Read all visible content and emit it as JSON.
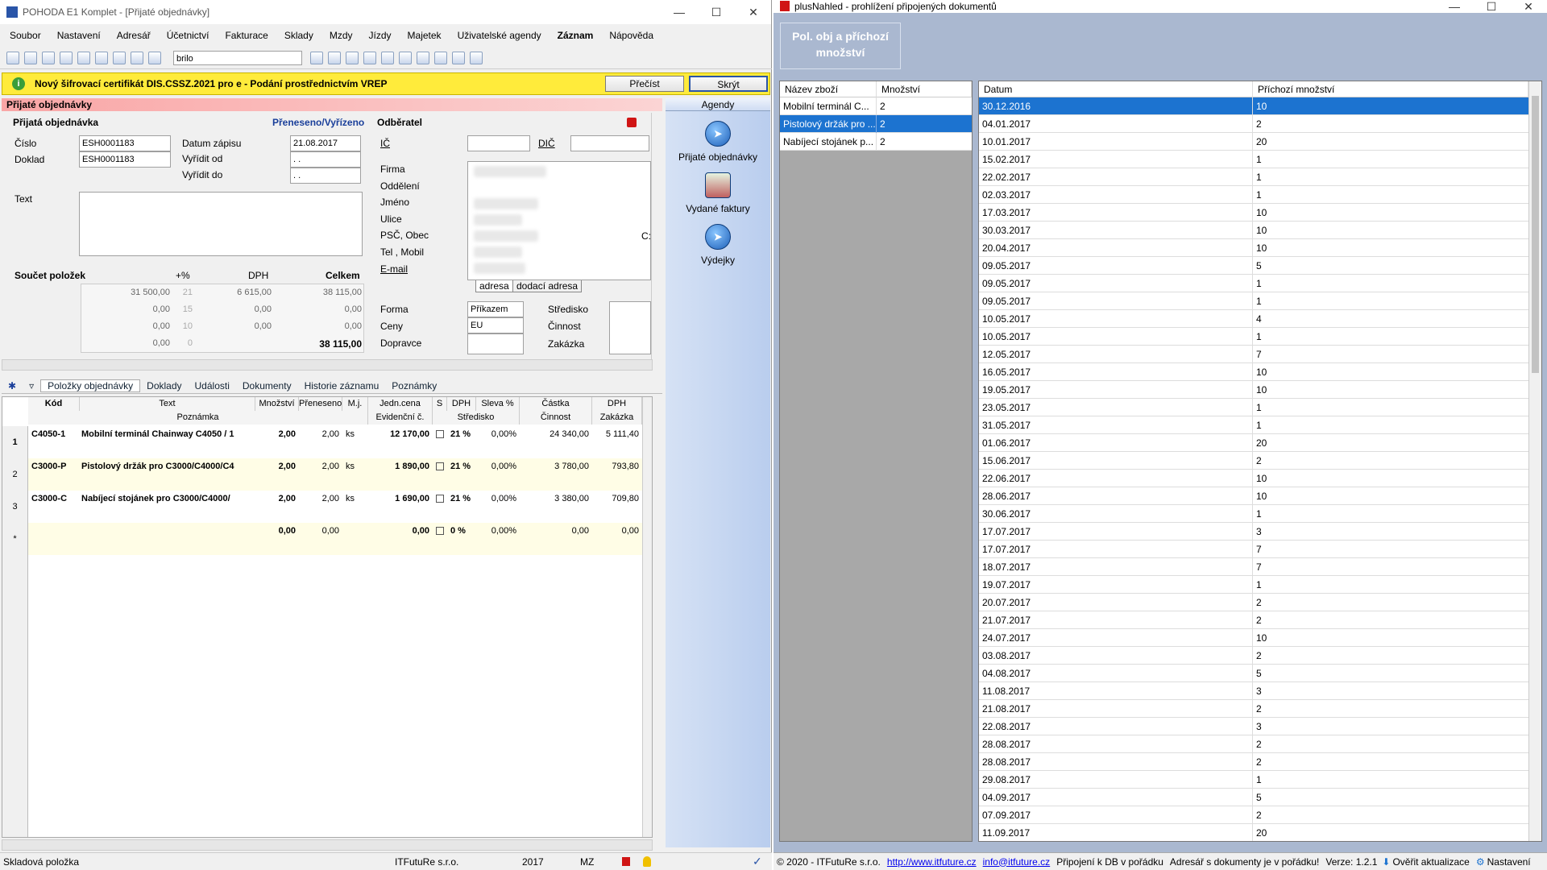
{
  "left": {
    "title": "POHODA E1 Komplet - [Přijaté objednávky]",
    "menu": [
      "Soubor",
      "Nastavení",
      "Adresář",
      "Účetnictví",
      "Fakturace",
      "Sklady",
      "Mzdy",
      "Jízdy",
      "Majetek",
      "Uživatelské agendy",
      "Záznam",
      "Nápověda"
    ],
    "search_value": "brilo",
    "notice": {
      "text": "Nový šifrovací certifikát DIS.CSSZ.2021 pro e - Podání prostřednictvím VREP",
      "read": "Přečíst",
      "hide": "Skrýt"
    },
    "section_title": "Přijaté objednávky",
    "form": {
      "order_label": "Přijatá objednávka",
      "status": "Přeneseno/Vyřízeno",
      "buyer": "Odběratel",
      "cislo_label": "Číslo",
      "cislo": "ESH0001183",
      "doklad_label": "Doklad",
      "doklad": "ESH0001183",
      "datum_zapisu_label": "Datum zápisu",
      "datum_zapisu": "21.08.2017",
      "vyridit_od_label": "Vyřídit od",
      "vyridit_od": ". .",
      "vyridit_do_label": "Vyřídit do",
      "vyridit_do": ". .",
      "text_label": "Text",
      "ic_label": "IČ",
      "dic_label": "DIČ",
      "firma": "Firma",
      "oddeleni": "Oddělení",
      "jmeno": "Jméno",
      "ulice": "Ulice",
      "psc": "PSČ, Obec",
      "tel": "Tel , Mobil",
      "email": "E-mail",
      "tab_adresa": "adresa",
      "tab_dodaci": "dodací adresa",
      "forma_label": "Forma",
      "forma": "Příkazem",
      "ceny_label": "Ceny",
      "ceny": "EU",
      "dopravce_label": "Dopravce",
      "stredisko": "Středisko",
      "cinnost": "Činnost",
      "zakazka": "Zakázka",
      "c_trunc": "C:"
    },
    "sums": {
      "title": "Součet položek",
      "pct": "+%",
      "dph": "DPH",
      "celkem": "Celkem",
      "rows": [
        [
          "31 500,00",
          "21",
          "6 615,00",
          "38 115,00"
        ],
        [
          "0,00",
          "15",
          "0,00",
          "0,00"
        ],
        [
          "0,00",
          "10",
          "0,00",
          "0,00"
        ],
        [
          "0,00",
          "0",
          "",
          "38 115,00"
        ]
      ]
    },
    "agenda": {
      "title": "Agendy",
      "items": [
        "Přijaté objednávky",
        "Vydané faktury",
        "Výdejky"
      ]
    },
    "tabs": [
      "Položky objednávky",
      "Doklady",
      "Události",
      "Dokumenty",
      "Historie záznamu",
      "Poznámky"
    ],
    "grid": {
      "headers1": [
        "Kód",
        "Text",
        "Množství",
        "Přeneseno",
        "M.j.",
        "Jedn.cena",
        "S",
        "DPH",
        "Sleva %",
        "Částka",
        "DPH"
      ],
      "headers2": [
        "Poznámka",
        "Evidenční č.",
        "Středisko",
        "Činnost",
        "Zakázka"
      ],
      "rows": [
        {
          "n": "1",
          "kod": "C4050-1",
          "text": "Mobilní terminál Chainway C4050 / 1",
          "mn": "2,00",
          "pr": "2,00",
          "mj": "ks",
          "cena": "12 170,00",
          "dph": "21 %",
          "sleva": "0,00%",
          "castka": "24 340,00",
          "dphv": "5 111,40"
        },
        {
          "n": "2",
          "kod": "C3000-P",
          "text": "Pistolový držák pro C3000/C4000/C4",
          "mn": "2,00",
          "pr": "2,00",
          "mj": "ks",
          "cena": "1 890,00",
          "dph": "21 %",
          "sleva": "0,00%",
          "castka": "3 780,00",
          "dphv": "793,80"
        },
        {
          "n": "3",
          "kod": "C3000-C",
          "text": "Nabíjecí stojánek pro C3000/C4000/",
          "mn": "2,00",
          "pr": "2,00",
          "mj": "ks",
          "cena": "1 690,00",
          "dph": "21 %",
          "sleva": "0,00%",
          "castka": "3 380,00",
          "dphv": "709,80"
        },
        {
          "n": "*",
          "kod": "",
          "text": "",
          "mn": "0,00",
          "pr": "0,00",
          "mj": "",
          "cena": "0,00",
          "dph": "0 %",
          "sleva": "0,00%",
          "castka": "0,00",
          "dphv": "0,00"
        }
      ]
    },
    "status": {
      "left": "Skladová položka",
      "company": "ITFutuRe s.r.o.",
      "year": "2017",
      "mz": "MZ"
    }
  },
  "right": {
    "title": "plusNahled - prohlížení připojených dokumentů",
    "banner": "Pol. obj a příchozí množství",
    "left_headers": [
      "Název zboží",
      "Množství"
    ],
    "left_rows": [
      [
        "Mobilní terminál C...",
        "2"
      ],
      [
        "Pistolový držák pro ...",
        "2"
      ],
      [
        "Nabíjecí stojánek p...",
        "2"
      ]
    ],
    "right_headers": [
      "Datum",
      "Příchozí množství"
    ],
    "right_rows": [
      [
        "30.12.2016",
        "10"
      ],
      [
        "04.01.2017",
        "2"
      ],
      [
        "10.01.2017",
        "20"
      ],
      [
        "15.02.2017",
        "1"
      ],
      [
        "22.02.2017",
        "1"
      ],
      [
        "02.03.2017",
        "1"
      ],
      [
        "17.03.2017",
        "10"
      ],
      [
        "30.03.2017",
        "10"
      ],
      [
        "20.04.2017",
        "10"
      ],
      [
        "09.05.2017",
        "5"
      ],
      [
        "09.05.2017",
        "1"
      ],
      [
        "09.05.2017",
        "1"
      ],
      [
        "10.05.2017",
        "4"
      ],
      [
        "10.05.2017",
        "1"
      ],
      [
        "12.05.2017",
        "7"
      ],
      [
        "16.05.2017",
        "10"
      ],
      [
        "19.05.2017",
        "10"
      ],
      [
        "23.05.2017",
        "1"
      ],
      [
        "31.05.2017",
        "1"
      ],
      [
        "01.06.2017",
        "20"
      ],
      [
        "15.06.2017",
        "2"
      ],
      [
        "22.06.2017",
        "10"
      ],
      [
        "28.06.2017",
        "10"
      ],
      [
        "30.06.2017",
        "1"
      ],
      [
        "17.07.2017",
        "3"
      ],
      [
        "17.07.2017",
        "7"
      ],
      [
        "18.07.2017",
        "7"
      ],
      [
        "19.07.2017",
        "1"
      ],
      [
        "20.07.2017",
        "2"
      ],
      [
        "21.07.2017",
        "2"
      ],
      [
        "24.07.2017",
        "10"
      ],
      [
        "03.08.2017",
        "2"
      ],
      [
        "04.08.2017",
        "5"
      ],
      [
        "11.08.2017",
        "3"
      ],
      [
        "21.08.2017",
        "2"
      ],
      [
        "22.08.2017",
        "3"
      ],
      [
        "28.08.2017",
        "2"
      ],
      [
        "28.08.2017",
        "2"
      ],
      [
        "29.08.2017",
        "1"
      ],
      [
        "04.09.2017",
        "5"
      ],
      [
        "07.09.2017",
        "2"
      ],
      [
        "11.09.2017",
        "20"
      ]
    ],
    "status": {
      "copy": "© 2020 - ITFutuRe s.r.o.",
      "url": "http://www.itfuture.cz",
      "mail": "info@itfuture.cz",
      "db": "Připojení k DB v pořádku",
      "adr": "Adresář s dokumenty je v pořádku!",
      "ver": "Verze: 1.2.1",
      "update": "Ověřit aktualizace",
      "settings": "Nastavení"
    }
  }
}
